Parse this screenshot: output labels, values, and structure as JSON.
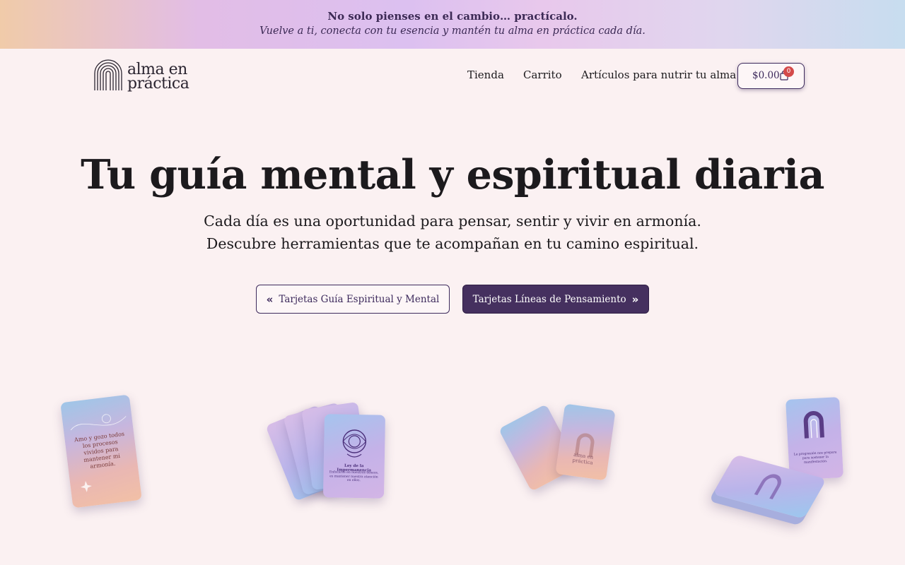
{
  "announcement": {
    "line1": "No solo pienses en el cambio… practícalo.",
    "line2": "Vuelve a ti, conecta con tu esencia y mantén tu alma en práctica cada día."
  },
  "logo": {
    "line1": "alma en",
    "line2": "práctica"
  },
  "nav": {
    "items": [
      {
        "label": "Tienda"
      },
      {
        "label": "Carrito"
      },
      {
        "label": "Artículos para nutrir tu alma"
      }
    ]
  },
  "cart": {
    "amount": "$0.00",
    "count": "0"
  },
  "hero": {
    "title": "Tu guía mental y espiritual diaria",
    "subtitle_line1": "Cada día es una oportunidad para pensar, sentir y vivir en armonía.",
    "subtitle_line2": "Descubre herramientas que te acompañan en tu camino espiritual.",
    "button_left": "Tarjetas Guía Espiritual y Mental",
    "button_right": "Tarjetas Líneas de Pensamiento"
  },
  "cards": {
    "card1_text": "Amo y gozo todos los procesos vividos para mantener mi armonía.",
    "card2_title": "Ley de la Impermanencia",
    "card2_text": "Enfocarse en nuestros deseos, es mantener nuestra atención en ellos.",
    "card3_logo": "alma en práctica",
    "card4_text": "La progresión nos prepara para sostener la manifestación."
  },
  "colors": {
    "accent": "#45305f",
    "badge": "#d44a4a",
    "background": "#fbf1f2"
  }
}
